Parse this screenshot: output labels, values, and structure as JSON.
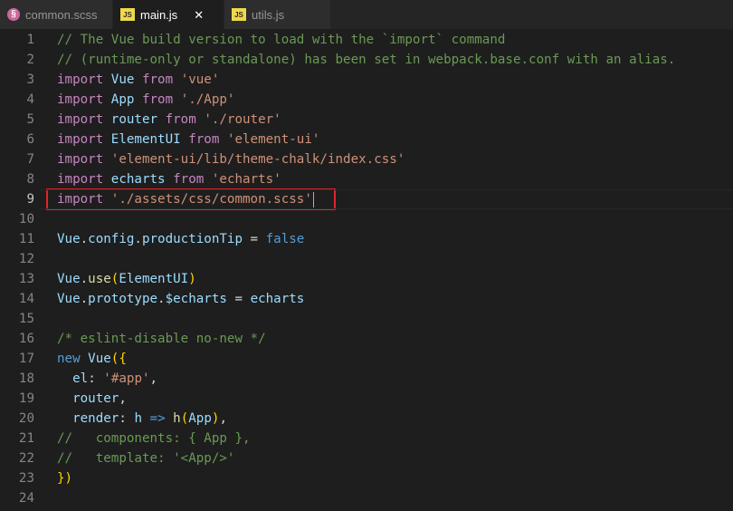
{
  "tabs": [
    {
      "label": "common.scss",
      "icon": "scss-icon",
      "icon_glyph": "§",
      "active": false
    },
    {
      "label": "main.js",
      "icon": "js-icon",
      "icon_glyph": "JS",
      "active": true,
      "close_glyph": "✕"
    },
    {
      "label": "utils.js",
      "icon": "js-icon",
      "icon_glyph": "JS",
      "active": false
    }
  ],
  "colors": {
    "background": "#1e1e1e",
    "comment": "#6a9955",
    "keyword": "#c586c0",
    "string": "#ce9178",
    "variable": "#9cdcfe",
    "boolean": "#569cd6",
    "highlight_box": "#e0242b"
  },
  "editor": {
    "current_line": 9,
    "lines": [
      {
        "num": "1",
        "tokens": [
          {
            "t": "// The Vue build version to load with the `import` command",
            "c": "cm"
          }
        ]
      },
      {
        "num": "2",
        "tokens": [
          {
            "t": "// (runtime-only or standalone) has been set in webpack.base.conf with an alias.",
            "c": "cm"
          }
        ]
      },
      {
        "num": "3",
        "tokens": [
          {
            "t": "import",
            "c": "kw"
          },
          {
            "t": " ",
            "c": "pl"
          },
          {
            "t": "Vue",
            "c": "id"
          },
          {
            "t": " ",
            "c": "pl"
          },
          {
            "t": "from",
            "c": "kw"
          },
          {
            "t": " ",
            "c": "pl"
          },
          {
            "t": "'vue'",
            "c": "str"
          }
        ]
      },
      {
        "num": "4",
        "tokens": [
          {
            "t": "import",
            "c": "kw"
          },
          {
            "t": " ",
            "c": "pl"
          },
          {
            "t": "App",
            "c": "id"
          },
          {
            "t": " ",
            "c": "pl"
          },
          {
            "t": "from",
            "c": "kw"
          },
          {
            "t": " ",
            "c": "pl"
          },
          {
            "t": "'./App'",
            "c": "str"
          }
        ]
      },
      {
        "num": "5",
        "tokens": [
          {
            "t": "import",
            "c": "kw"
          },
          {
            "t": " ",
            "c": "pl"
          },
          {
            "t": "router",
            "c": "id"
          },
          {
            "t": " ",
            "c": "pl"
          },
          {
            "t": "from",
            "c": "kw"
          },
          {
            "t": " ",
            "c": "pl"
          },
          {
            "t": "'./router'",
            "c": "str"
          }
        ]
      },
      {
        "num": "6",
        "tokens": [
          {
            "t": "import",
            "c": "kw"
          },
          {
            "t": " ",
            "c": "pl"
          },
          {
            "t": "ElementUI",
            "c": "id"
          },
          {
            "t": " ",
            "c": "pl"
          },
          {
            "t": "from",
            "c": "kw"
          },
          {
            "t": " ",
            "c": "pl"
          },
          {
            "t": "'element-ui'",
            "c": "str"
          }
        ]
      },
      {
        "num": "7",
        "tokens": [
          {
            "t": "import",
            "c": "kw"
          },
          {
            "t": " ",
            "c": "pl"
          },
          {
            "t": "'element-ui/lib/theme-chalk/index.css'",
            "c": "str"
          }
        ]
      },
      {
        "num": "8",
        "tokens": [
          {
            "t": "import",
            "c": "kw"
          },
          {
            "t": " ",
            "c": "pl"
          },
          {
            "t": "echarts",
            "c": "id"
          },
          {
            "t": " ",
            "c": "pl"
          },
          {
            "t": "from",
            "c": "kw"
          },
          {
            "t": " ",
            "c": "pl"
          },
          {
            "t": "'echarts'",
            "c": "str"
          }
        ]
      },
      {
        "num": "9",
        "tokens": [
          {
            "t": "import",
            "c": "kw"
          },
          {
            "t": " ",
            "c": "pl"
          },
          {
            "t": "'./assets/css/common.scss'",
            "c": "str"
          }
        ],
        "cursor": true
      },
      {
        "num": "10",
        "tokens": []
      },
      {
        "num": "11",
        "tokens": [
          {
            "t": "Vue",
            "c": "id"
          },
          {
            "t": ".",
            "c": "pl"
          },
          {
            "t": "config",
            "c": "id"
          },
          {
            "t": ".",
            "c": "pl"
          },
          {
            "t": "productionTip",
            "c": "id"
          },
          {
            "t": " = ",
            "c": "pl"
          },
          {
            "t": "false",
            "c": "bl"
          }
        ]
      },
      {
        "num": "12",
        "tokens": []
      },
      {
        "num": "13",
        "tokens": [
          {
            "t": "Vue",
            "c": "id"
          },
          {
            "t": ".",
            "c": "pl"
          },
          {
            "t": "use",
            "c": "fn"
          },
          {
            "t": "(",
            "c": "br"
          },
          {
            "t": "ElementUI",
            "c": "id"
          },
          {
            "t": ")",
            "c": "br"
          }
        ]
      },
      {
        "num": "14",
        "tokens": [
          {
            "t": "Vue",
            "c": "id"
          },
          {
            "t": ".",
            "c": "pl"
          },
          {
            "t": "prototype",
            "c": "id"
          },
          {
            "t": ".",
            "c": "pl"
          },
          {
            "t": "$echarts",
            "c": "id"
          },
          {
            "t": " = ",
            "c": "pl"
          },
          {
            "t": "echarts",
            "c": "id"
          }
        ]
      },
      {
        "num": "15",
        "tokens": []
      },
      {
        "num": "16",
        "tokens": [
          {
            "t": "/* eslint-disable no-new */",
            "c": "cm"
          }
        ]
      },
      {
        "num": "17",
        "tokens": [
          {
            "t": "new",
            "c": "bl"
          },
          {
            "t": " ",
            "c": "pl"
          },
          {
            "t": "Vue",
            "c": "id"
          },
          {
            "t": "({",
            "c": "br"
          }
        ]
      },
      {
        "num": "18",
        "tokens": [
          {
            "t": "  ",
            "c": "pl"
          },
          {
            "t": "el",
            "c": "id"
          },
          {
            "t": ": ",
            "c": "pl"
          },
          {
            "t": "'#app'",
            "c": "str"
          },
          {
            "t": ",",
            "c": "pl"
          }
        ]
      },
      {
        "num": "19",
        "tokens": [
          {
            "t": "  ",
            "c": "pl"
          },
          {
            "t": "router",
            "c": "id"
          },
          {
            "t": ",",
            "c": "pl"
          }
        ]
      },
      {
        "num": "20",
        "tokens": [
          {
            "t": "  ",
            "c": "pl"
          },
          {
            "t": "render",
            "c": "id"
          },
          {
            "t": ": ",
            "c": "pl"
          },
          {
            "t": "h",
            "c": "id"
          },
          {
            "t": " ",
            "c": "pl"
          },
          {
            "t": "=>",
            "c": "bl"
          },
          {
            "t": " ",
            "c": "pl"
          },
          {
            "t": "h",
            "c": "fn"
          },
          {
            "t": "(",
            "c": "br"
          },
          {
            "t": "App",
            "c": "id"
          },
          {
            "t": ")",
            "c": "br"
          },
          {
            "t": ",",
            "c": "pl"
          }
        ]
      },
      {
        "num": "21",
        "tokens": [
          {
            "t": "//   components: { App },",
            "c": "cm"
          }
        ]
      },
      {
        "num": "22",
        "tokens": [
          {
            "t": "//   template: '<App/>'",
            "c": "cm"
          }
        ]
      },
      {
        "num": "23",
        "tokens": [
          {
            "t": "})",
            "c": "br"
          }
        ]
      },
      {
        "num": "24",
        "tokens": []
      }
    ]
  }
}
